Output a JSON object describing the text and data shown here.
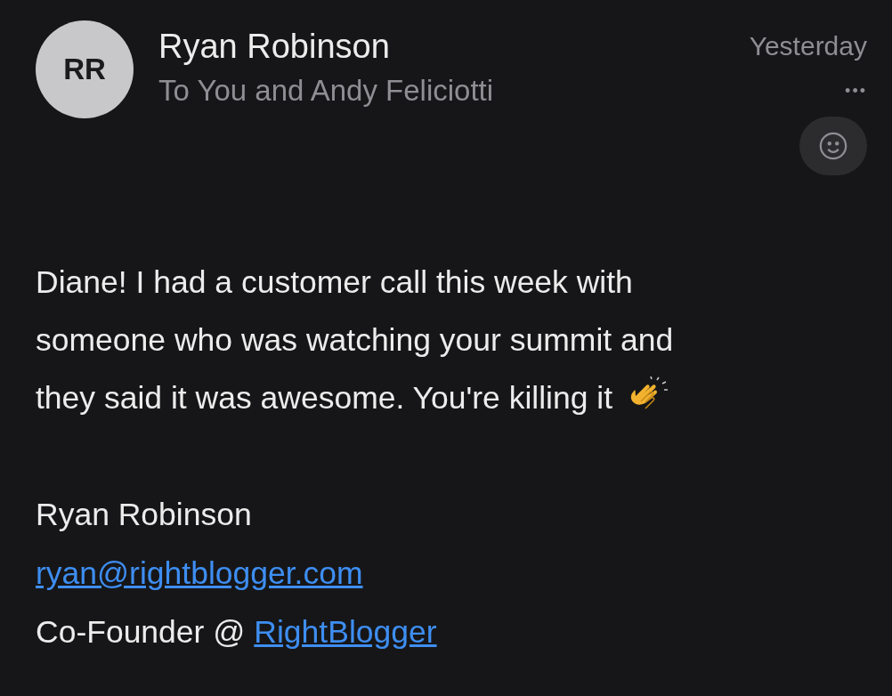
{
  "message": {
    "avatar_initials": "RR",
    "sender": "Ryan Robinson",
    "recipients": "To You and Andy Feliciotti",
    "time": "Yesterday",
    "more": "•••"
  },
  "body_lines": [
    "Diane! I had a customer call this week with",
    "someone who was watching your summit and",
    "they said it was awesome. You're killing it"
  ],
  "signature": {
    "name": "Ryan Robinson",
    "email": "ryan@rightblogger.com",
    "title": "Co-Founder @",
    "company": "RightBlogger"
  }
}
